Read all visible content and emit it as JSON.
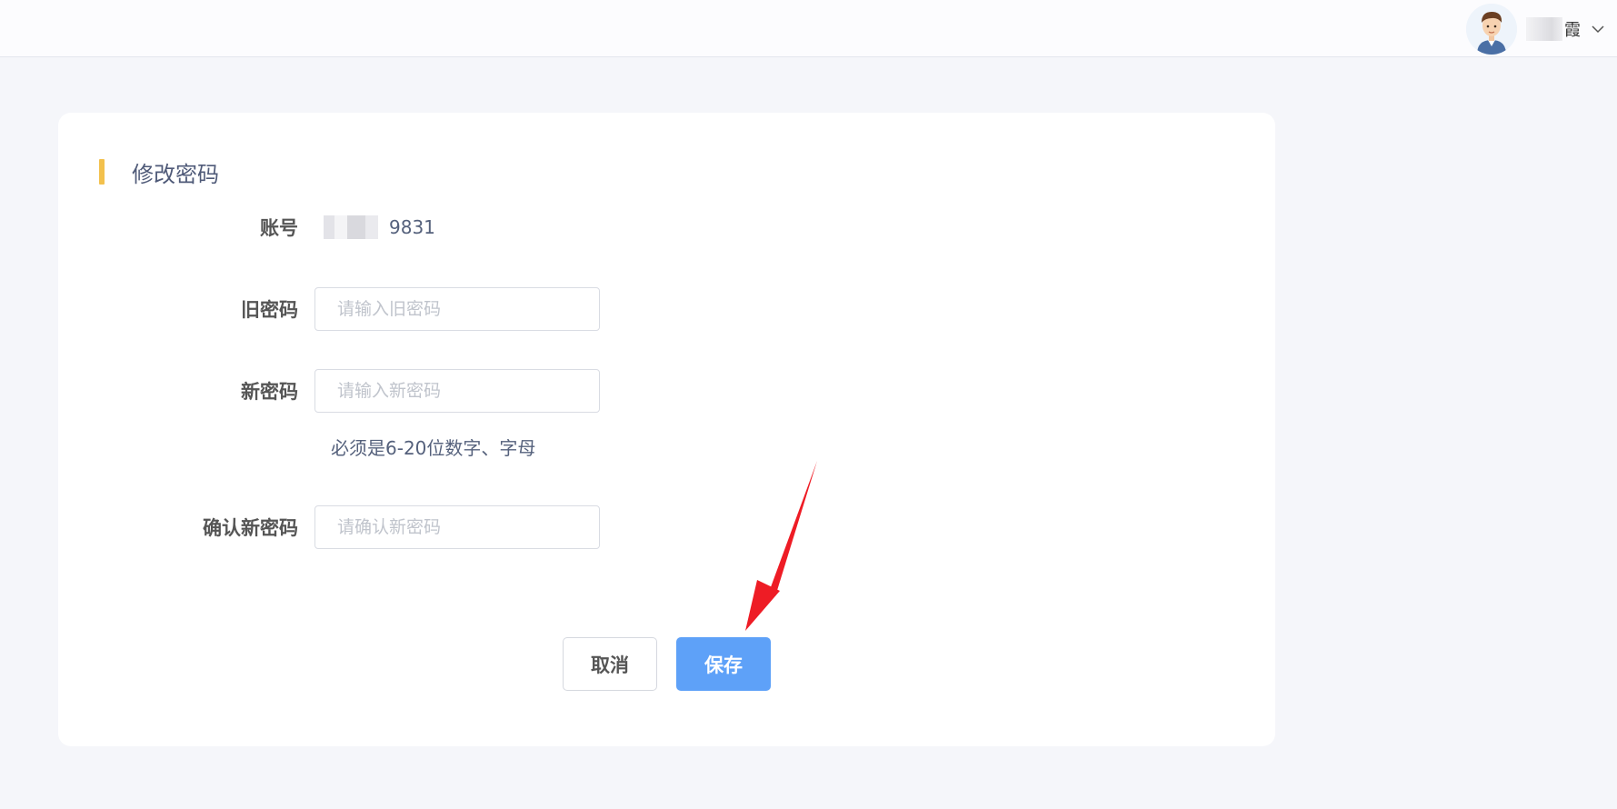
{
  "header": {
    "user_name_suffix": "霞",
    "avatar_icon": "user-avatar-icon",
    "dropdown_icon": "chevron-down-icon"
  },
  "form": {
    "title": "修改密码",
    "accent_color": "#f3c14d",
    "account": {
      "label": "账号",
      "value_suffix": "9831"
    },
    "old_password": {
      "label": "旧密码",
      "placeholder": "请输入旧密码",
      "value": ""
    },
    "new_password": {
      "label": "新密码",
      "placeholder": "请输入新密码",
      "value": "",
      "hint": "必须是6-20位数字、字母"
    },
    "confirm_password": {
      "label": "确认新密码",
      "placeholder": "请确认新密码",
      "value": ""
    }
  },
  "actions": {
    "cancel_label": "取消",
    "save_label": "保存",
    "primary_color": "#5ea1f8"
  },
  "annotation": {
    "arrow_color": "#ee1c25",
    "target": "save-button"
  }
}
